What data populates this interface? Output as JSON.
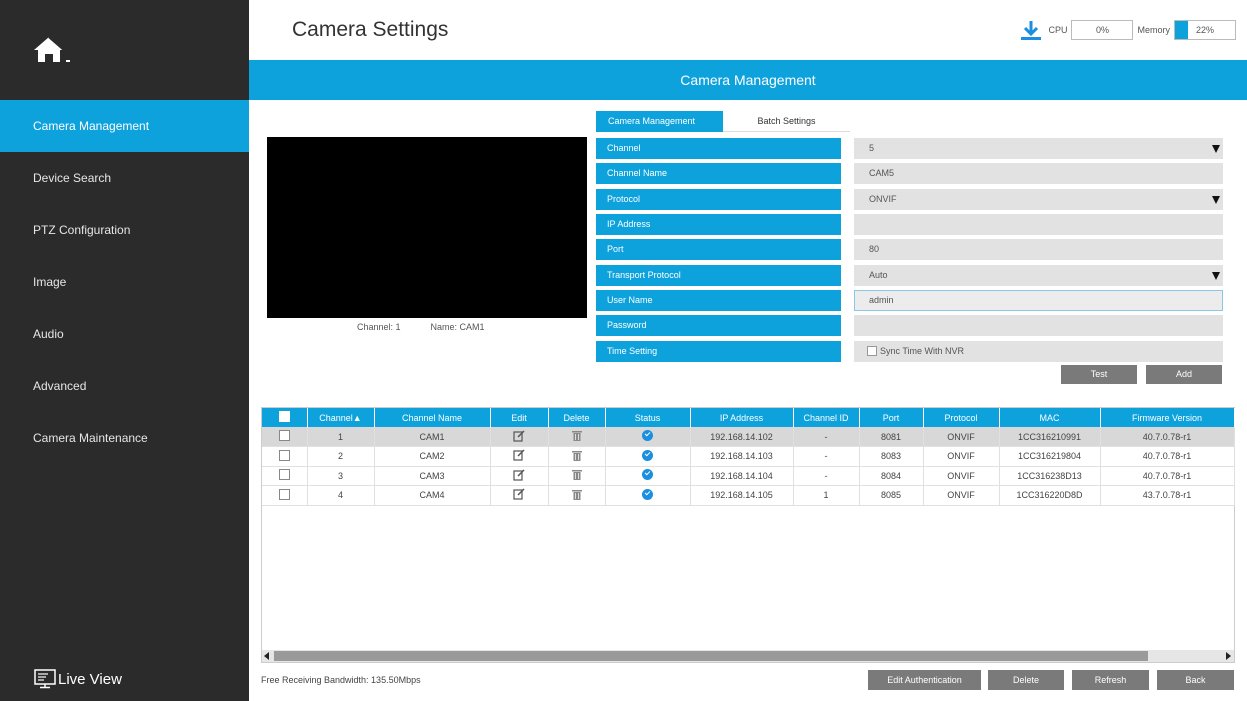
{
  "sidebar": {
    "items": [
      {
        "label": "Camera Management"
      },
      {
        "label": "Device Search"
      },
      {
        "label": "PTZ Configuration"
      },
      {
        "label": "Image"
      },
      {
        "label": "Audio"
      },
      {
        "label": "Advanced"
      },
      {
        "label": "Camera Maintenance"
      }
    ],
    "active_index": 0,
    "live_view_label": "Live View"
  },
  "header": {
    "title": "Camera Settings",
    "cpu_label": "CPU",
    "cpu_value": "0%",
    "cpu_fraction": 0.0,
    "memory_label": "Memory",
    "memory_value": "22%",
    "memory_fraction": 0.22
  },
  "banner": {
    "title": "Camera Management"
  },
  "preview": {
    "channel": "Channel: 1",
    "name": "Name: CAM1"
  },
  "tabs": [
    {
      "label": "Camera Management",
      "active": true
    },
    {
      "label": "Batch Settings",
      "active": false
    }
  ],
  "form": {
    "channel_label": "Channel",
    "channel_value": "5",
    "channel_name_label": "Channel Name",
    "channel_name_value": "CAM5",
    "protocol_label": "Protocol",
    "protocol_value": "ONVIF",
    "ip_label": "IP Address",
    "ip_value": "",
    "port_label": "Port",
    "port_value": "80",
    "transport_label": "Transport Protocol",
    "transport_value": "Auto",
    "username_label": "User Name",
    "username_value": "admin",
    "password_label": "Password",
    "password_value": "",
    "time_label": "Time Setting",
    "sync_label": "Sync Time With NVR",
    "test_button": "Test",
    "add_button": "Add"
  },
  "table": {
    "headers": [
      "",
      "Channel▲",
      "Channel Name",
      "Edit",
      "Delete",
      "Status",
      "IP Address",
      "Channel ID",
      "Port",
      "Protocol",
      "MAC",
      "Firmware Version"
    ],
    "rows": [
      {
        "channel": "1",
        "name": "CAM1",
        "ip": "192.168.14.102",
        "channel_id": "-",
        "port": "8081",
        "protocol": "ONVIF",
        "mac": "1CC316210991",
        "firmware": "40.7.0.78-r1"
      },
      {
        "channel": "2",
        "name": "CAM2",
        "ip": "192.168.14.103",
        "channel_id": "-",
        "port": "8083",
        "protocol": "ONVIF",
        "mac": "1CC316219804",
        "firmware": "40.7.0.78-r1"
      },
      {
        "channel": "3",
        "name": "CAM3",
        "ip": "192.168.14.104",
        "channel_id": "-",
        "port": "8084",
        "protocol": "ONVIF",
        "mac": "1CC316238D13",
        "firmware": "40.7.0.78-r1"
      },
      {
        "channel": "4",
        "name": "CAM4",
        "ip": "192.168.14.105",
        "channel_id": "1",
        "port": "8085",
        "protocol": "ONVIF",
        "mac": "1CC316220D8D",
        "firmware": "43.7.0.78-r1"
      }
    ]
  },
  "footer": {
    "bandwidth": "Free Receiving Bandwidth: 135.50Mbps",
    "edit_auth_button": "Edit Authentication",
    "delete_button": "Delete",
    "refresh_button": "Refresh",
    "back_button": "Back"
  },
  "colors": {
    "accent": "#0ea2dd",
    "sidebar": "#2b2b2b",
    "button": "#7a7a7a"
  }
}
